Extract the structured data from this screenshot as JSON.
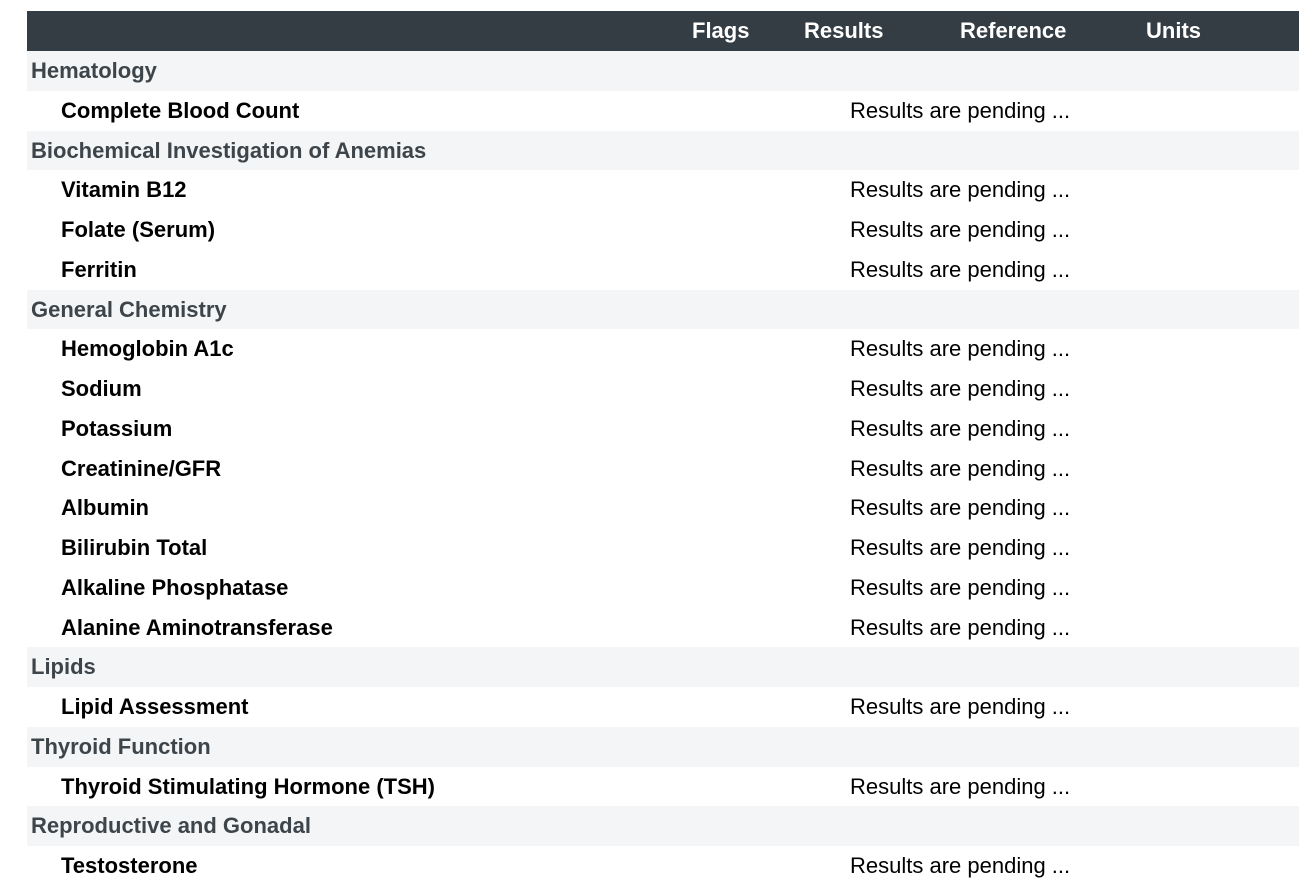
{
  "header": {
    "flags": "Flags",
    "results": "Results",
    "reference": "Reference",
    "units": "Units"
  },
  "rows": [
    {
      "type": "section",
      "label": "Hematology"
    },
    {
      "type": "test",
      "label": "Complete Blood Count",
      "result": "Results are pending ..."
    },
    {
      "type": "section",
      "label": "Biochemical Investigation of Anemias"
    },
    {
      "type": "test",
      "label": "Vitamin B12",
      "result": "Results are pending ..."
    },
    {
      "type": "test",
      "label": "Folate (Serum)",
      "result": "Results are pending ..."
    },
    {
      "type": "test",
      "label": "Ferritin",
      "result": "Results are pending ..."
    },
    {
      "type": "section",
      "label": "General Chemistry"
    },
    {
      "type": "test",
      "label": "Hemoglobin A1c",
      "result": "Results are pending ..."
    },
    {
      "type": "test",
      "label": "Sodium",
      "result": "Results are pending ..."
    },
    {
      "type": "test",
      "label": "Potassium",
      "result": "Results are pending ..."
    },
    {
      "type": "test",
      "label": "Creatinine/GFR",
      "result": "Results are pending ..."
    },
    {
      "type": "test",
      "label": "Albumin",
      "result": "Results are pending ..."
    },
    {
      "type": "test",
      "label": "Bilirubin Total",
      "result": "Results are pending ..."
    },
    {
      "type": "test",
      "label": "Alkaline Phosphatase",
      "result": "Results are pending ..."
    },
    {
      "type": "test",
      "label": "Alanine Aminotransferase",
      "result": "Results are pending ..."
    },
    {
      "type": "section",
      "label": "Lipids"
    },
    {
      "type": "test",
      "label": "Lipid Assessment",
      "result": "Results are pending ..."
    },
    {
      "type": "section",
      "label": "Thyroid Function"
    },
    {
      "type": "test",
      "label": "Thyroid Stimulating Hormone (TSH)",
      "result": "Results are pending ..."
    },
    {
      "type": "section",
      "label": "Reproductive and Gonadal"
    },
    {
      "type": "test",
      "label": "Testosterone",
      "result": "Results are pending ..."
    }
  ]
}
